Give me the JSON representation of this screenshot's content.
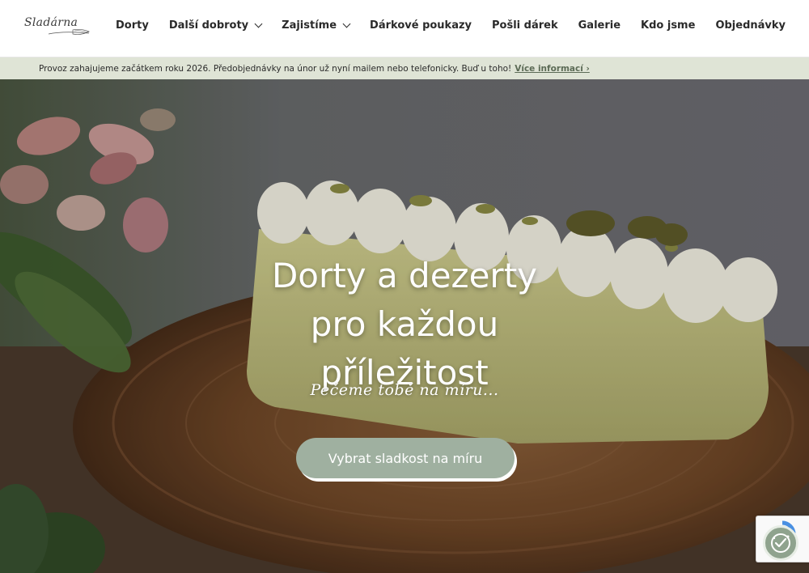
{
  "header": {
    "logo_text": "Sladárna",
    "nav": [
      {
        "label": "Dorty",
        "has_dropdown": false
      },
      {
        "label": "Další dobroty",
        "has_dropdown": true
      },
      {
        "label": "Zajistíme",
        "has_dropdown": true
      },
      {
        "label": "Dárkové poukazy",
        "has_dropdown": false
      },
      {
        "label": "Pošli dárek",
        "has_dropdown": false
      },
      {
        "label": "Galerie",
        "has_dropdown": false
      },
      {
        "label": "Kdo jsme",
        "has_dropdown": false
      },
      {
        "label": "Objednávky",
        "has_dropdown": false
      }
    ]
  },
  "notice": {
    "text": "Provoz zahajujeme začátkem roku 2026. Předobjednávky na únor už nyní mailem nebo telefonicky. Buď u toho!",
    "link_label": "Více informací ›"
  },
  "hero": {
    "title_lines": [
      "Dorty a dezerty",
      "pro každou",
      "příležitost"
    ],
    "subtitle": "Pečeme tobě na míru...",
    "button_label": "Vybrat sladkost na míru"
  },
  "colors": {
    "notice_bg": "#dfe4d6",
    "button_bg": "#9fb0a0",
    "link_color": "#5c6b56"
  },
  "widgets": {
    "recaptcha_icon": "recaptcha-logo",
    "cookie_icon": "cookie-check-icon"
  }
}
